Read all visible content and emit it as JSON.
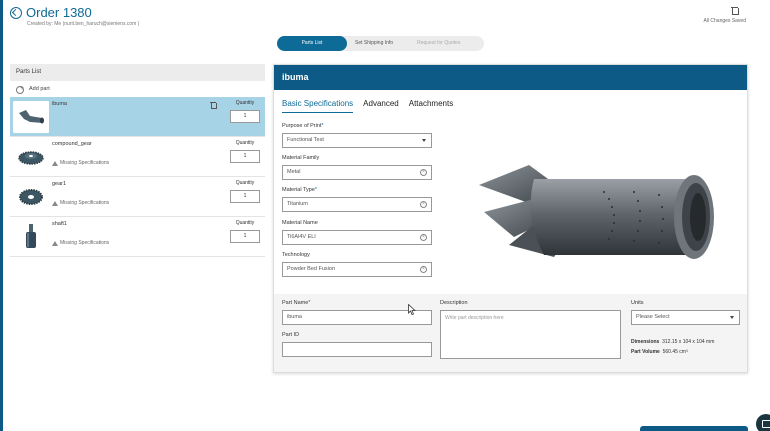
{
  "header": {
    "title": "Order 1380",
    "created_by": "Created by: Me (nurit.ben_haruch@siemens.com )",
    "status": "All Changes Saved"
  },
  "stepper": {
    "steps": [
      "Parts List",
      "Set Shipping Info",
      "Request for Quotes"
    ]
  },
  "parts_panel": {
    "title": "Parts List",
    "add_label": "Add part",
    "quantity_label": "Quantity",
    "items": [
      {
        "name": "ibuma",
        "quantity": "1",
        "warning": ""
      },
      {
        "name": "compound_gear",
        "quantity": "1",
        "warning": "Missing Specifications"
      },
      {
        "name": "gear1",
        "quantity": "1",
        "warning": "Missing Specifications"
      },
      {
        "name": "shaft1",
        "quantity": "1",
        "warning": "Missing Specifications"
      }
    ]
  },
  "detail": {
    "title": "ibuma",
    "tabs": [
      "Basic Specifications",
      "Advanced",
      "Attachments"
    ],
    "purpose_label": "Purpose of Print",
    "purpose_value": "Functional Test",
    "material_family_label": "Material Family",
    "material_family_value": "Metal",
    "material_type_label": "Material Type",
    "material_type_value": "Titanium",
    "material_name_label": "Material Name",
    "material_name_value": "Ti6Al4V ELI",
    "technology_label": "Technology",
    "technology_value": "Powder Bed Fusion",
    "part_name_label": "Part Name",
    "part_name_value": "ibuma",
    "part_id_label": "Part ID",
    "part_id_value": "",
    "description_label": "Description",
    "description_placeholder": "Write part description here",
    "units_label": "Units",
    "units_value": "Please Select",
    "dimensions_label": "Dimensions",
    "dimensions_value": "312.15 x 104 x 104 mm",
    "volume_label": "Part Volume",
    "volume_value": "560.45 cm³"
  },
  "colors": {
    "brand": "#0e5a86",
    "selected_row": "#a7d3e6"
  }
}
